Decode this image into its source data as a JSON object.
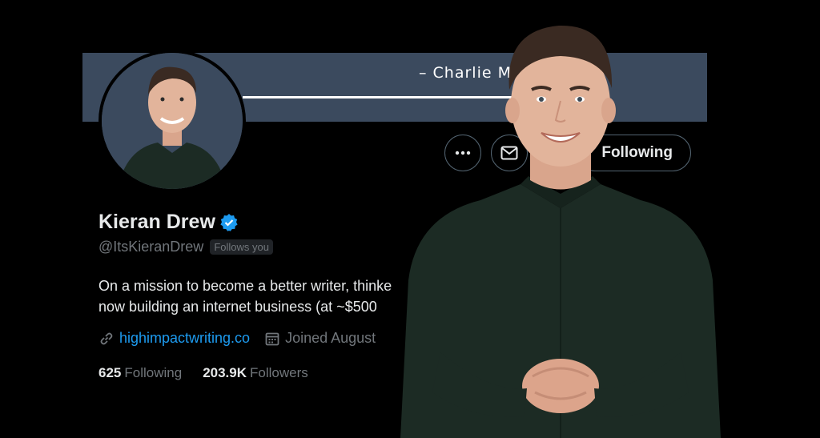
{
  "banner": {
    "quote_attribution": "– Charlie M"
  },
  "profile": {
    "name": "Kieran Drew",
    "handle": "@ItsKieranDrew",
    "follows_you": "Follows you",
    "bio_lines": [
      "On a mission to become a better writer, thinke",
      "now building an internet business (at ~$500"
    ],
    "website": "highimpactwriting.co",
    "joined": "Joined August",
    "following_count": "625",
    "following_label": "Following",
    "followers_count": "203.9K",
    "followers_label": "Followers"
  },
  "actions": {
    "more_icon": "more-icon",
    "message_icon": "mail-icon",
    "following_button": "Following"
  },
  "colors": {
    "background": "#000000",
    "banner": "#3b4a5e",
    "link": "#1d9bf0",
    "verified": "#1d9bf0",
    "muted_text": "#71767b",
    "primary_text": "#e7e9ea",
    "shirt": "#1c2b24"
  }
}
